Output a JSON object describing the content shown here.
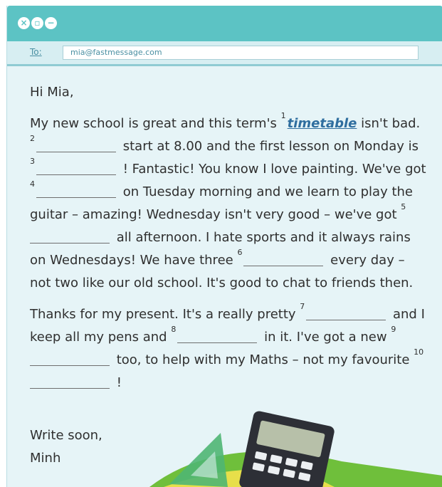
{
  "window": {
    "controls": [
      "close-icon",
      "minimize-icon",
      "collapse-icon"
    ]
  },
  "header": {
    "to_label": "To:",
    "to_value": "mia@fastmessage.com"
  },
  "letter": {
    "greeting": "Hi Mia,",
    "p1": {
      "t1": "My new school is great and this term's ",
      "n1": "1",
      "answer1": "timetable",
      "t2": " isn't bad. ",
      "n2": "2",
      "t3": " start at 8.00 and the first lesson on Monday is ",
      "n3": "3",
      "t4": " ! Fantastic! You know I love painting. We've got ",
      "n4": "4",
      "t5": " on Tuesday morning and we learn to play the guitar – amazing! Wednesday isn't very good – we've got ",
      "n5": "5",
      "t6": " all afternoon. I hate sports and it always rains on Wednesdays! We have three ",
      "n6": "6",
      "t7": " every day – not two like our old school. It's good to chat to friends then."
    },
    "p2": {
      "t1": "Thanks for my present. It's a really pretty ",
      "n7": "7",
      "t2": " and I keep all my pens and ",
      "n8": "8",
      "t3": " in it. I've got a new ",
      "n9": "9",
      "t4": " too, to help with my Maths – not my favourite ",
      "n10": "10",
      "t5": " !"
    },
    "closing": "Write soon,",
    "signature": "Minh"
  },
  "colors": {
    "titlebar": "#5cc3c4",
    "background": "#e6f4f7",
    "answer": "#2f6e9f"
  }
}
